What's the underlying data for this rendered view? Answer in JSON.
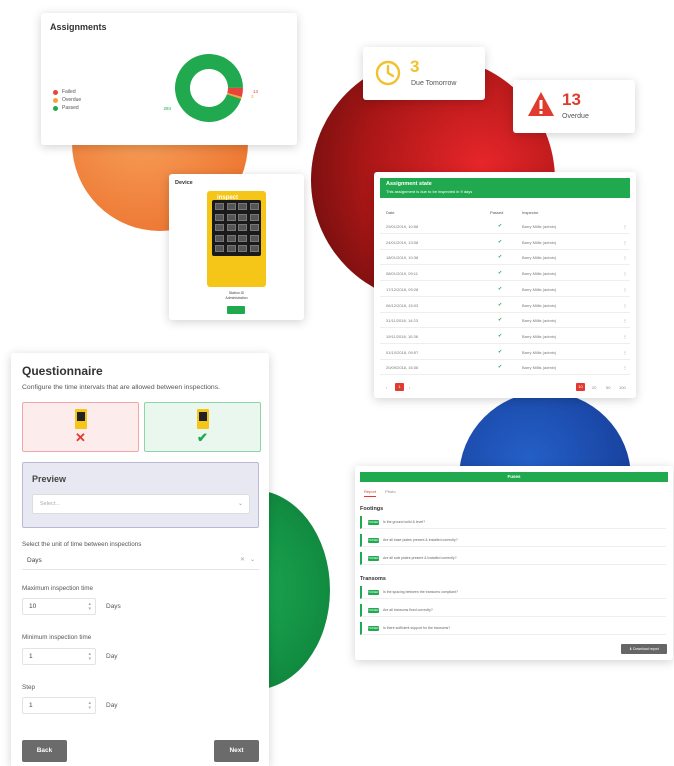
{
  "assignments": {
    "title": "Assignments",
    "legend": [
      {
        "label": "Failed",
        "color": "#e8443a"
      },
      {
        "label": "Overdue",
        "color": "#f2a33a"
      },
      {
        "label": "Passed",
        "color": "#21a94f"
      }
    ],
    "chart_data": {
      "type": "pie",
      "categories": [
        "Passed",
        "Failed",
        "Overdue"
      ],
      "values": [
        284,
        13,
        3
      ],
      "data_labels": [
        "284",
        "13",
        "3"
      ]
    }
  },
  "due": {
    "count": "3",
    "label": "Due Tomorrow",
    "color": "#f2c12e"
  },
  "overdue": {
    "count": "13",
    "label": "Overdue",
    "color": "#e03b2e"
  },
  "device": {
    "title": "Device",
    "brand": "inspect",
    "caption_line1": "Station ID",
    "caption_line2": "Administration"
  },
  "state": {
    "title": "Assignment state",
    "subtitle": "This assignment is due to be inspected in 9 days",
    "columns": [
      "Date",
      "Passed",
      "Inspector"
    ],
    "rows": [
      {
        "date": "29/01/2019, 10:58",
        "inspector": "Barry Millis (admin)"
      },
      {
        "date": "24/01/2019, 13:08",
        "inspector": "Barry Millis (admin)"
      },
      {
        "date": "18/01/2019, 10:38",
        "inspector": "Barry Millis (admin)"
      },
      {
        "date": "08/01/2019, 09:11",
        "inspector": "Barry Millis (admin)"
      },
      {
        "date": "17/12/2018, 09:28",
        "inspector": "Barry Millis (admin)"
      },
      {
        "date": "06/12/2018, 15:03",
        "inspector": "Barry Millis (admin)"
      },
      {
        "date": "31/11/2018, 14:23",
        "inspector": "Barry Millis (admin)"
      },
      {
        "date": "19/11/2018, 10:36",
        "inspector": "Barry Millis (admin)"
      },
      {
        "date": "01/10/2018, 09:57",
        "inspector": "Barry Millis (admin)"
      },
      {
        "date": "20/09/2018, 16:36",
        "inspector": "Barry Millis (admin)"
      }
    ],
    "pager": {
      "prev": "‹",
      "current": "1",
      "next": "›",
      "sizes": [
        "10",
        "20",
        "50",
        "100"
      ]
    }
  },
  "questionnaire": {
    "title": "Questionnaire",
    "subtitle": "Configure the time intervals that are allowed between inspections.",
    "preview_title": "Preview",
    "preview_placeholder": "Select...",
    "unit_label": "Select the unit of time between inspections",
    "unit_value": "Days",
    "max_label": "Maximum inspection time",
    "max_value": "10",
    "max_unit": "Days",
    "min_label": "Minimum inspection time",
    "min_value": "1",
    "min_unit": "Day",
    "step_label": "Step",
    "step_value": "1",
    "step_unit": "Day",
    "back": "Back",
    "next": "Next"
  },
  "report": {
    "title": "Fuses",
    "tabs": [
      "Report",
      "Photo"
    ],
    "sections": [
      {
        "name": "Footings",
        "items": [
          "Is the ground solid & level?",
          "Are all base plates present & installed correctly?",
          "Are all sole plates present & installed correctly?"
        ]
      },
      {
        "name": "Transoms",
        "items": [
          "Is the spacing between the transoms compliant?",
          "Are all transoms fixed correctly?",
          "Is there sufficient support for the transoms?"
        ]
      }
    ],
    "pill": "PASSED",
    "download": "Download report"
  }
}
